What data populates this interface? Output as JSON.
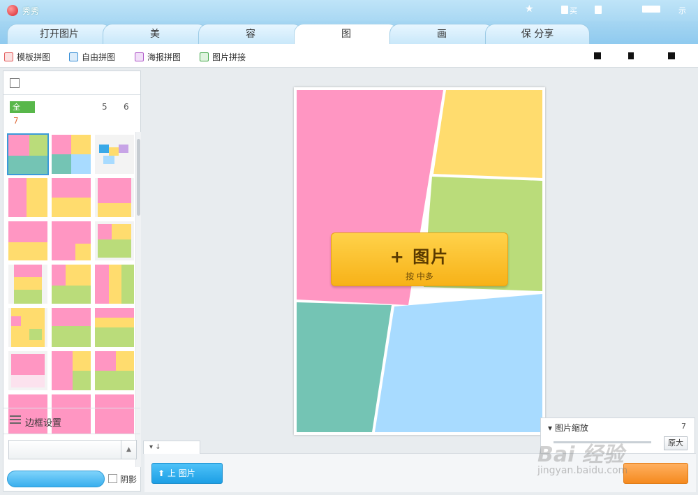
{
  "app": {
    "title": "秀秀"
  },
  "titlebar_right": {
    "item_1": "买",
    "item_2": "示"
  },
  "tabs": [
    {
      "label": "打开图片"
    },
    {
      "label": "美"
    },
    {
      "label": "容"
    },
    {
      "label": "图"
    },
    {
      "label": "画"
    },
    {
      "label": "保  分享"
    }
  ],
  "subtoolbar": [
    {
      "label": "模板拼图",
      "icon": "template-collage-icon",
      "color": "#e25c5c"
    },
    {
      "label": "自由拼图",
      "icon": "free-collage-icon",
      "color": "#3a8fd6"
    },
    {
      "label": "海报拼图",
      "icon": "poster-collage-icon",
      "color": "#b05ac8"
    },
    {
      "label": "图片拼接",
      "icon": "image-stitch-icon",
      "color": "#43a84a"
    }
  ],
  "leftpanel": {
    "header": "",
    "filters": {
      "active": "全",
      "a": "5",
      "b": "6",
      "c": "7"
    },
    "border_settings": "边框设置",
    "shadow_label": "阴影"
  },
  "canvas": {
    "add_main": "+   图片",
    "add_sub": "按           中多"
  },
  "zoom": {
    "title": "图片缩放",
    "value": "7",
    "original": "原大"
  },
  "bottom": {
    "upload": "上   图片"
  },
  "watermark": {
    "main": "Bai 经验",
    "url": "jingyan.baidu.com"
  },
  "colors": {
    "pink": "#ff96c2",
    "yellow": "#ffdc6e",
    "green": "#badc7a",
    "teal": "#74c4b4",
    "blue": "#a8dbff",
    "accent": "#2e9bd6"
  }
}
